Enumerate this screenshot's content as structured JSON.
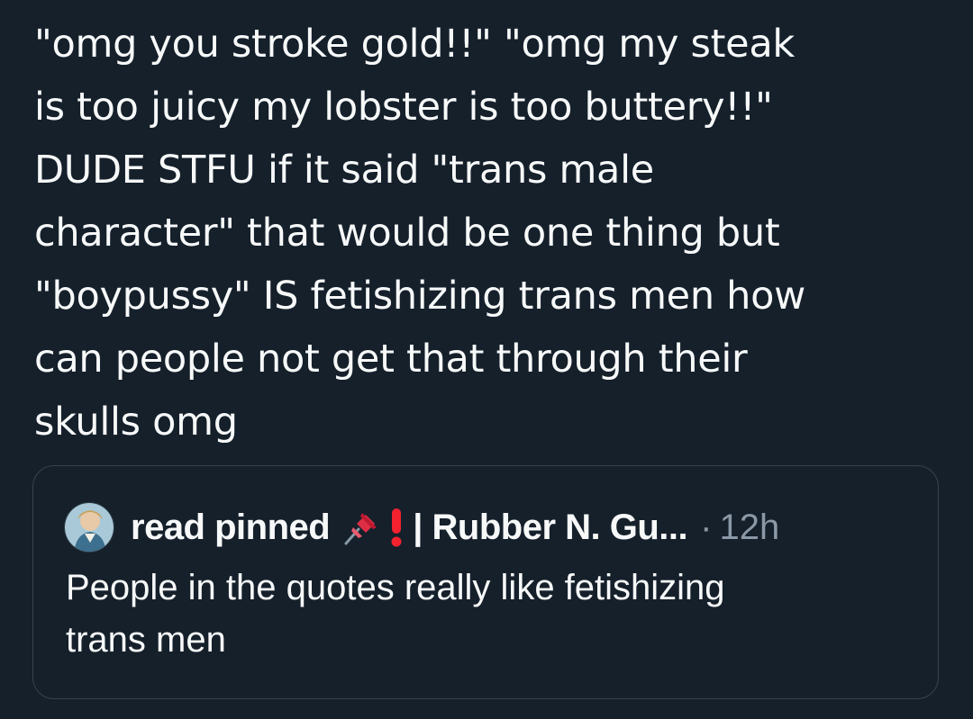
{
  "tweet": {
    "text_lines": [
      "\"omg you stroke gold!!\" \"omg my steak",
      "is too juicy my lobster is too buttery!!\"",
      "DUDE STFU if it said \"trans male",
      "character\" that would be one thing but",
      "\"boypussy\" IS fetishizing trans men how",
      "can people not get that through their",
      "skulls omg"
    ]
  },
  "quote": {
    "author_name": "read pinned",
    "author_name_rest": "| Rubber N. Gu...",
    "separator": "·",
    "time": "12h",
    "text_lines": [
      "People in the quotes really like fetishizing",
      "trans men"
    ],
    "icons": [
      "avatar-image",
      "pushpin-icon",
      "exclamation-icon"
    ]
  },
  "colors": {
    "background": "#15202b",
    "text": "#f7f9f9",
    "muted": "#8b98a5",
    "border": "#38444d",
    "exclamation": "#f4212e"
  }
}
